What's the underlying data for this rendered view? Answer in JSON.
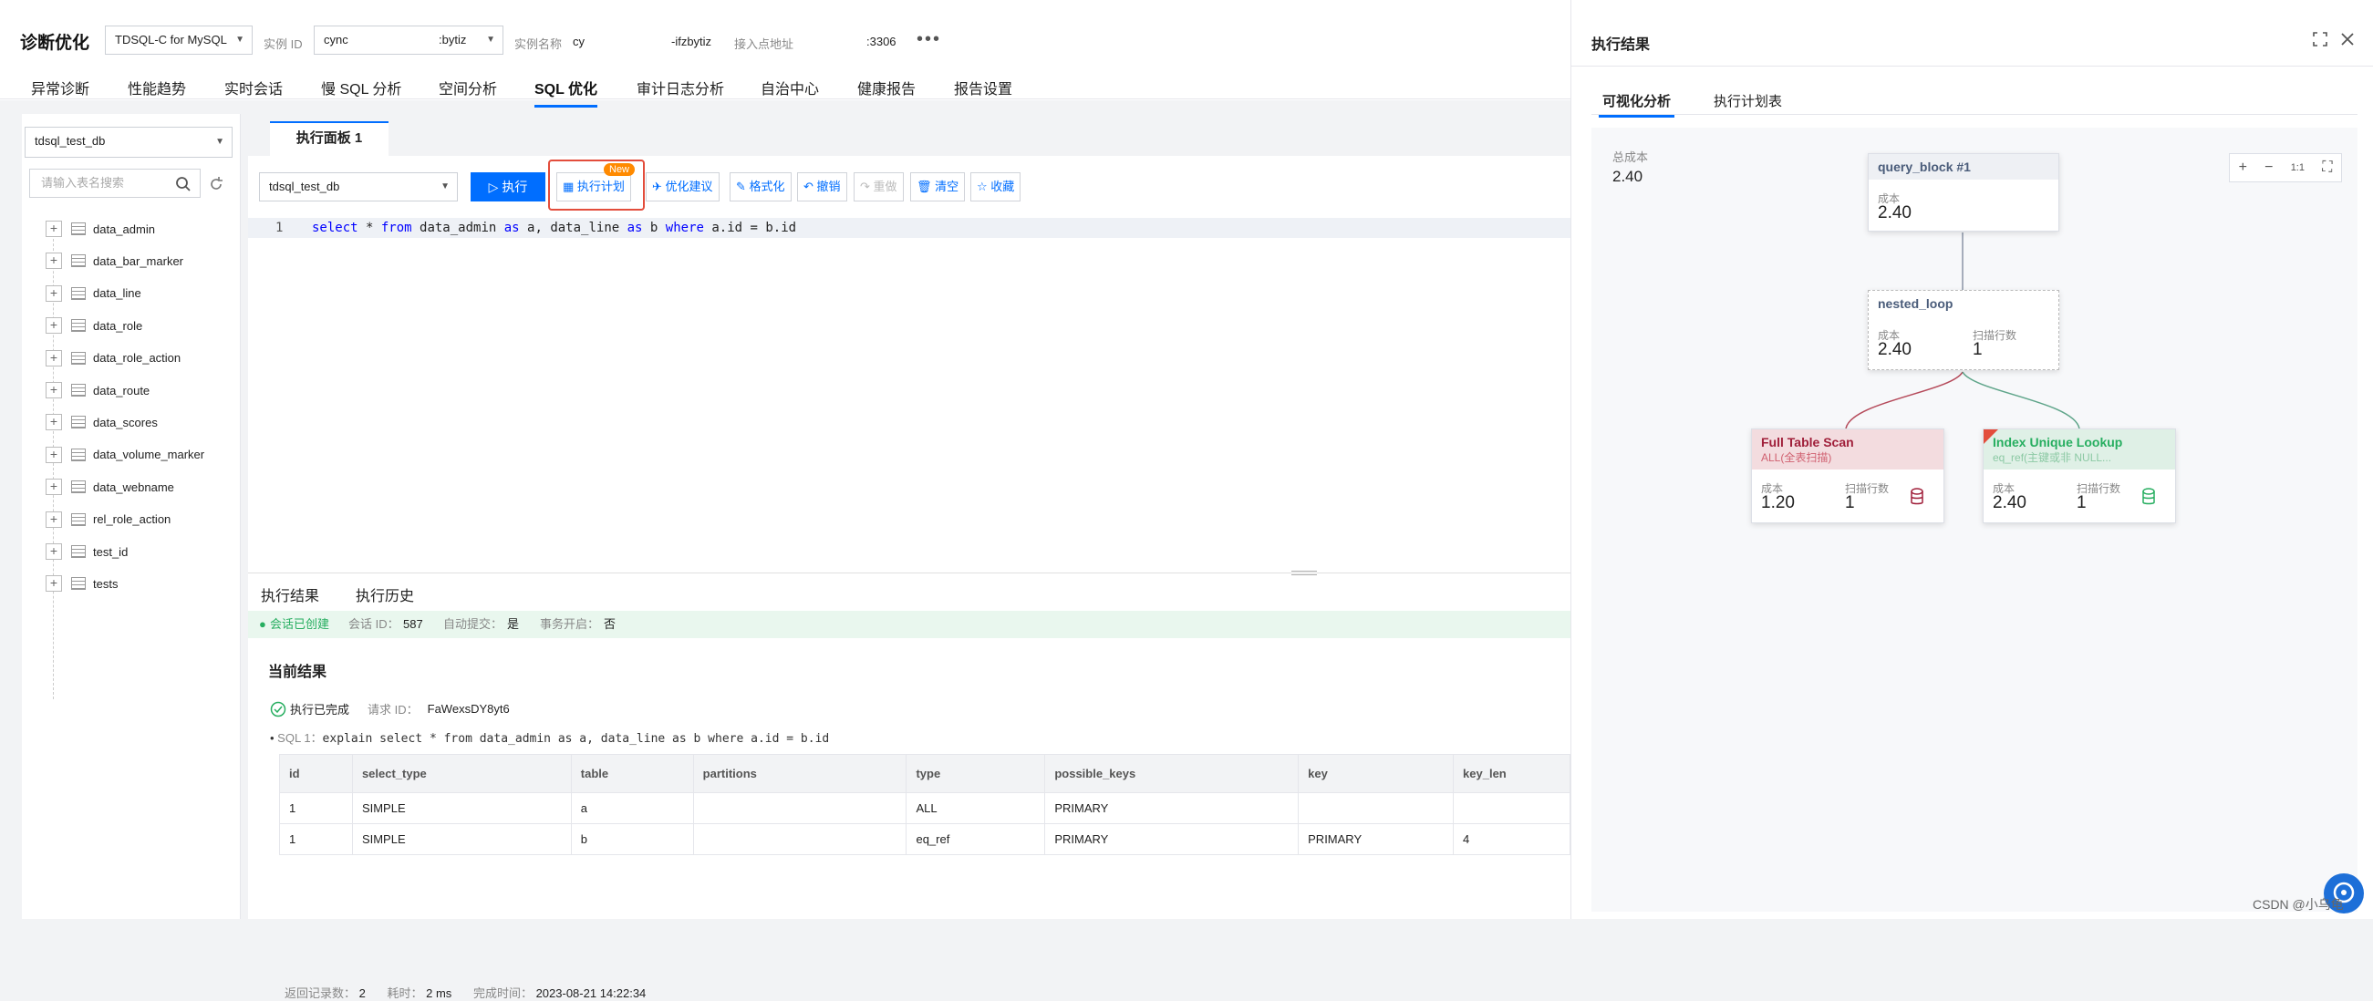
{
  "header": {
    "title": "诊断优化",
    "db_type": "TDSQL-C for MySQL",
    "instance_id_label": "实例 ID",
    "instance_id_value": "cync",
    "instance_id_value2": ":bytiz",
    "instance_name_label": "实例名称",
    "instance_name_value": "cy",
    "instance_name_value2": "-ifzbytiz",
    "access_label": "接入点地址",
    "access_value": ":3306",
    "more": "•••"
  },
  "nav": {
    "tabs": [
      "异常诊断",
      "性能趋势",
      "实时会话",
      "慢 SQL 分析",
      "空间分析",
      "SQL 优化",
      "审计日志分析",
      "自治中心",
      "健康报告",
      "报告设置"
    ],
    "active_index": 5
  },
  "left": {
    "db_select": "tdsql_test_db",
    "search_placeholder": "请输入表名搜索",
    "tables": [
      "data_admin",
      "data_bar_marker",
      "data_line",
      "data_role",
      "data_role_action",
      "data_route",
      "data_scores",
      "data_volume_marker",
      "data_webname",
      "rel_role_action",
      "test_id",
      "tests"
    ]
  },
  "editor": {
    "tab_label": "执行面板 1",
    "db_select": "tdsql_test_db",
    "run": "执行",
    "plan": "执行计划",
    "new_badge": "New",
    "advice": "优化建议",
    "format": "格式化",
    "undo": "撤销",
    "redo": "重做",
    "clear": "清空",
    "favorite": "收藏",
    "line_no": "1"
  },
  "results": {
    "tab_result": "执行结果",
    "tab_history": "执行历史",
    "session_created": "会话已创建",
    "session_id_label": "会话 ID：",
    "session_id": "587",
    "autocommit_label": "自动提交：",
    "autocommit": "是",
    "txn_label": "事务开启：",
    "txn": "否",
    "current_title": "当前结果",
    "done_label": "执行已完成",
    "request_label": "请求 ID：",
    "request_id": "FaWexsDY8yt6",
    "sql_prefix": "SQL 1：",
    "sql_text": "explain select * from data_admin as a, data_line as b where a.id = b.id",
    "columns": [
      "id",
      "select_type",
      "table",
      "partitions",
      "type",
      "possible_keys",
      "key",
      "key_len"
    ],
    "rows": [
      [
        "1",
        "SIMPLE",
        "a",
        "",
        "ALL",
        "PRIMARY",
        "",
        ""
      ],
      [
        "1",
        "SIMPLE",
        "b",
        "",
        "eq_ref",
        "PRIMARY",
        "PRIMARY",
        "4"
      ]
    ],
    "rows_label": "返回记录数：",
    "rows_count": "2",
    "time_label": "耗时：",
    "time_value": "2 ms",
    "finished_label": "完成时间：",
    "finished_value": "2023-08-21 14:22:34"
  },
  "panel": {
    "title": "执行结果",
    "tab_visual": "可视化分析",
    "tab_table": "执行计划表",
    "total_cost_label": "总成本",
    "total_cost": "2.40",
    "zoom_in": "+",
    "zoom_out": "−",
    "zoom_reset": "1:1",
    "nodes": {
      "query_block": {
        "title": "query_block #1",
        "cost_label": "成本",
        "cost": "2.40"
      },
      "nested_loop": {
        "title": "nested_loop",
        "cost_label": "成本",
        "cost": "2.40",
        "rows_label": "扫描行数",
        "rows": "1"
      },
      "full_scan": {
        "title": "Full Table Scan",
        "sub": "ALL(全表扫描)",
        "cost_label": "成本",
        "cost": "1.20",
        "rows_label": "扫描行数",
        "rows": "1"
      },
      "index_lookup": {
        "title": "Index Unique Lookup",
        "sub": "eq_ref(主键或非 NULL...",
        "cost_label": "成本",
        "cost": "2.40",
        "rows_label": "扫描行数",
        "rows": "1"
      }
    },
    "watermark": "CSDN @小乌龟"
  },
  "colors": {
    "accent": "#006eff",
    "danger": "#e34d3c",
    "success": "#27ae60"
  }
}
